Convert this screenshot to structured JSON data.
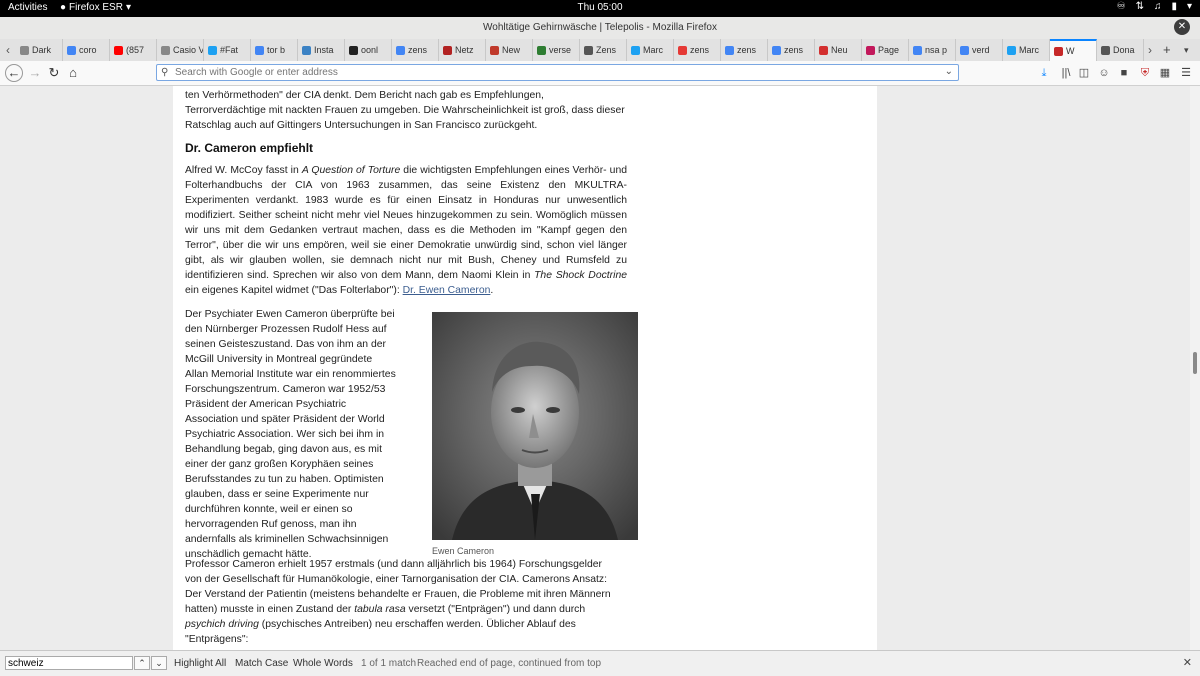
{
  "topbar": {
    "activities": "Activities",
    "app": "Firefox ESR",
    "clock": "Thu 05:00"
  },
  "window": {
    "title": "Wohltätige Gehirnwäsche | Telepolis - Mozilla Firefox"
  },
  "tabs": [
    {
      "label": "Dark",
      "icon": "page-icon",
      "color": "#888888"
    },
    {
      "label": "coro",
      "icon": "google-icon",
      "color": "#4285f4"
    },
    {
      "label": "(857",
      "icon": "youtube-icon",
      "color": "#ff0000"
    },
    {
      "label": "Casio Vi",
      "icon": "page-icon",
      "color": "#888888"
    },
    {
      "label": "#Fat",
      "icon": "twitter-icon",
      "color": "#1da1f2"
    },
    {
      "label": "tor b",
      "icon": "google-icon",
      "color": "#4285f4"
    },
    {
      "label": "Insta",
      "icon": "globe-icon",
      "color": "#3b82c4"
    },
    {
      "label": "oonl",
      "icon": "github-icon",
      "color": "#222222"
    },
    {
      "label": "zens",
      "icon": "google-icon",
      "color": "#4285f4"
    },
    {
      "label": "Netz",
      "icon": "netz-icon",
      "color": "#b22222"
    },
    {
      "label": "New",
      "icon": "news-icon",
      "color": "#c0392b"
    },
    {
      "label": "verse",
      "icon": "trend-icon",
      "color": "#2e7d32"
    },
    {
      "label": "Zens",
      "icon": "wikipedia-icon",
      "color": "#555555"
    },
    {
      "label": "Marc",
      "icon": "twitter-icon",
      "color": "#1da1f2"
    },
    {
      "label": "zens",
      "icon": "yandex-icon",
      "color": "#e53935"
    },
    {
      "label": "zens",
      "icon": "google-icon",
      "color": "#4285f4"
    },
    {
      "label": "zens",
      "icon": "google-icon",
      "color": "#4285f4"
    },
    {
      "label": "Neu",
      "icon": "shield-icon",
      "color": "#d32f2f"
    },
    {
      "label": "Page",
      "icon": "sg-icon",
      "color": "#c2185b"
    },
    {
      "label": "nsa p",
      "icon": "google-icon",
      "color": "#4285f4"
    },
    {
      "label": "verd",
      "icon": "google-icon",
      "color": "#4285f4"
    },
    {
      "label": "Marc",
      "icon": "twitter-icon",
      "color": "#1da1f2"
    },
    {
      "label": "W",
      "icon": "telepolis-icon",
      "color": "#c62828",
      "active": true
    },
    {
      "label": "Dona",
      "icon": "wikipedia-icon",
      "color": "#555555"
    }
  ],
  "urlbar": {
    "placeholder": "Search with Google or enter address",
    "value": ""
  },
  "article": {
    "p0": "ten Verhörmethoden\" der CIA denkt. Dem Bericht nach gab es Empfehlungen, Terrorverdächtige mit nackten Frauen zu umgeben. Die Wahrscheinlichkeit ist groß, dass dieser Ratschlag auch auf Gittingers Untersuchungen in San Francisco zurückgeht.",
    "heading": "Dr. Cameron empfiehlt",
    "p1_a": "Alfred W. McCoy fasst in ",
    "p1_b": "A Question of Torture",
    "p1_c": " die wichtigsten Empfehlungen eines Verhör- und Folterhandbuchs der CIA von 1963 zusammen, das seine Existenz den MKULTRA-Experimenten verdankt. 1983 wurde es für einen Einsatz in Honduras nur unwesentlich modifiziert. Seither scheint nicht mehr viel Neues hinzugekommen zu sein. Womöglich müssen wir uns mit dem Gedanken vertraut machen, dass es die Methoden im \"Kampf gegen den Terror\", über die wir uns empören, weil sie einer Demokratie unwürdig sind, schon viel länger gibt, als wir glauben wollen, sie demnach nicht nur mit Bush, Cheney und Rumsfeld zu identifizieren sind. Sprechen wir also von dem Mann, dem Naomi Klein in ",
    "p1_d": "The Shock Doctrine",
    "p1_e": " ein eigenes Kapitel widmet (\"Das Folterlabor\"): ",
    "p1_link": "Dr. Ewen Cameron",
    "p1_f": ".",
    "p2": "Der Psychiater Ewen Cameron überprüfte bei den Nürnberger Prozessen Rudolf Hess auf seinen Geisteszustand. Das von ihm an der McGill University in Montreal gegründete Allan Memorial Institute war ein renommiertes Forschungszentrum. Cameron war 1952/53 Präsident der American Psychiatric Association und später Präsident der World Psychiatric Association. Wer sich bei ihm in Behandlung begab, ging davon aus, es mit einer der ganz großen Koryphäen seines Berufsstandes zu tun zu haben. Optimisten glauben, dass er seine Experimente nur durchführen konnte, weil er einen so hervorragenden Ruf genoss, man ihn andernfalls als kriminellen Schwachsinnigen unschädlich gemacht hätte.",
    "caption": "Ewen Cameron",
    "p3_a": "Professor Cameron erhielt 1957 erstmals (und dann alljährlich bis 1964) Forschungsgelder von der Gesellschaft für Humanökologie, einer Tarnorganisation der CIA. Camerons Ansatz: Der Verstand der Patientin (meistens behandelte er Frauen, die Probleme mit ihren Männern hatten) musste in einen Zustand der ",
    "p3_b": "tabula rasa",
    "p3_c": " versetzt (\"Entprägen\") und dann durch ",
    "p3_d": "psychich driving",
    "p3_e": " (psychisches Antreiben) neu erschaffen werden. Üblicher Ablauf des \"Entprägens\":"
  },
  "findbar": {
    "query": "schweiz",
    "highlight_all": "Highlight All",
    "match_case": "Match Case",
    "whole_words": "Whole Words",
    "match_count": "1 of 1 match",
    "status": "Reached end of page, continued from top"
  },
  "colors": {
    "accent": "#0a84ff",
    "link": "#3b5d8f"
  }
}
